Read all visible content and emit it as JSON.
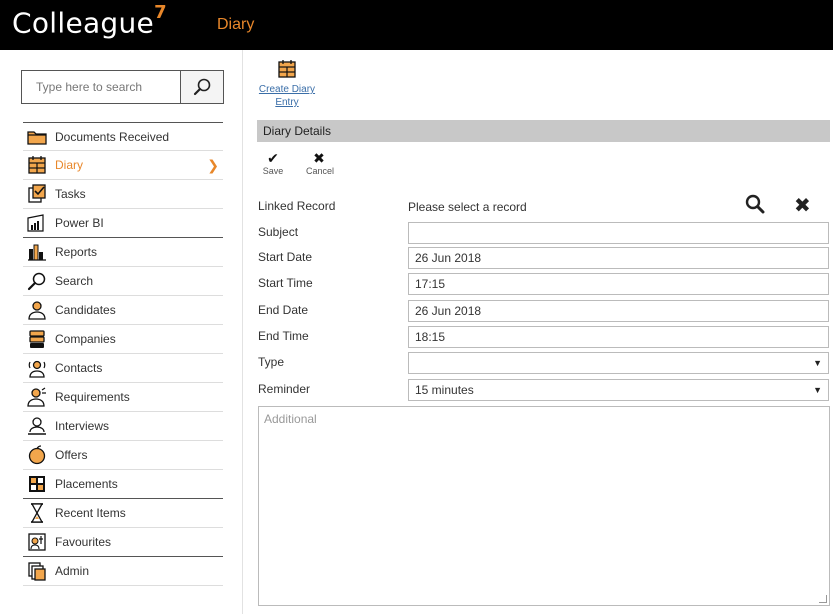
{
  "header": {
    "brand": "Colleague",
    "brand_version": "7",
    "section": "Diary"
  },
  "search": {
    "placeholder": "Type here to search"
  },
  "sidebar": {
    "items": [
      {
        "label": "Documents Received",
        "icon": "folder-icon"
      },
      {
        "label": "Diary",
        "icon": "calendar-icon",
        "active": true
      },
      {
        "label": "Tasks",
        "icon": "tasks-icon"
      },
      {
        "label": "Power BI",
        "icon": "power-bi-icon"
      },
      {
        "label": "Reports",
        "icon": "bar-chart-icon"
      },
      {
        "label": "Search",
        "icon": "magnifier-icon"
      },
      {
        "label": "Candidates",
        "icon": "person-icon"
      },
      {
        "label": "Companies",
        "icon": "building-icon"
      },
      {
        "label": "Contacts",
        "icon": "contact-icon"
      },
      {
        "label": "Requirements",
        "icon": "requirement-icon"
      },
      {
        "label": "Interviews",
        "icon": "interview-icon"
      },
      {
        "label": "Offers",
        "icon": "apple-icon"
      },
      {
        "label": "Placements",
        "icon": "placement-icon"
      },
      {
        "label": "Recent Items",
        "icon": "hourglass-icon"
      },
      {
        "label": "Favourites",
        "icon": "favourites-icon"
      },
      {
        "label": "Admin",
        "icon": "admin-icon"
      }
    ]
  },
  "actions": {
    "create_diary_line1": "Create Diary",
    "create_diary_line2": "Entry"
  },
  "panel": {
    "title": "Diary Details"
  },
  "toolbar": {
    "save_label": "Save",
    "cancel_label": "Cancel"
  },
  "form": {
    "linked_record_label": "Linked Record",
    "linked_record_value": "Please select a record",
    "subject_label": "Subject",
    "subject_value": "",
    "start_date_label": "Start Date",
    "start_date_value": "26 Jun 2018",
    "start_time_label": "Start Time",
    "start_time_value": "17:15",
    "end_date_label": "End Date",
    "end_date_value": "26 Jun 2018",
    "end_time_label": "End Time",
    "end_time_value": "18:15",
    "type_label": "Type",
    "type_value": "",
    "reminder_label": "Reminder",
    "reminder_value": "15 minutes",
    "additional_placeholder": "Additional"
  },
  "colors": {
    "accent": "#e8872a",
    "topbar": "#000000",
    "panel_header": "#c8c8c8",
    "link": "#3a6ea8"
  }
}
